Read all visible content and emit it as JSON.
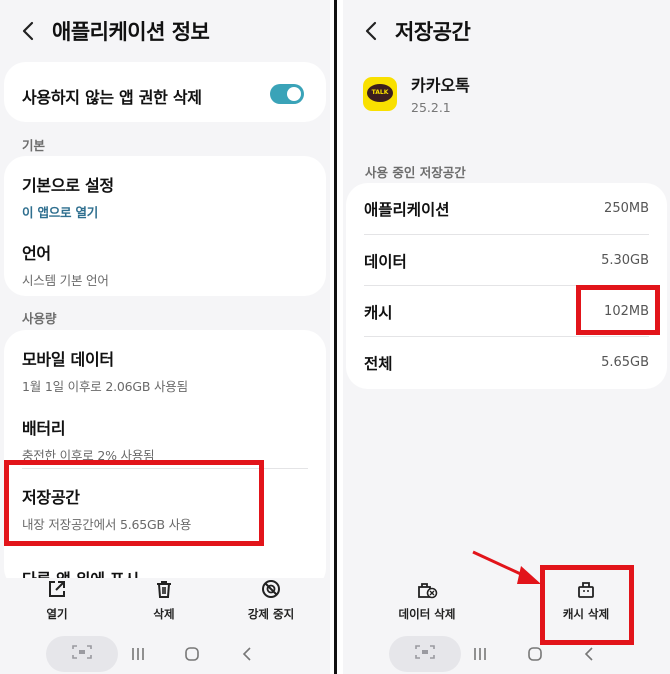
{
  "left_screen": {
    "title": "애플리케이션 정보",
    "toggle_row": {
      "title": "사용하지 않는 앱 권한 삭제",
      "enabled": true
    },
    "section_basic": "기본",
    "basic_items": [
      {
        "title": "기본으로 설정",
        "subtitle": "이 앱으로 열기"
      },
      {
        "title": "언어",
        "subtitle": "시스템 기본 언어"
      }
    ],
    "section_usage": "사용량",
    "usage_items": [
      {
        "title": "모바일 데이터",
        "subtitle": "1월 1일 이후로 2.06GB 사용됨"
      },
      {
        "title": "배터리",
        "subtitle": "충전한 이후로 2% 사용됨"
      },
      {
        "title": "저장공간",
        "subtitle": "내장 저장공간에서 5.65GB 사용"
      },
      {
        "title": "다른 앱 위에 표시",
        "subtitle": ""
      }
    ],
    "bottom_actions": [
      {
        "label": "열기",
        "icon": "open-external-icon"
      },
      {
        "label": "삭제",
        "icon": "trash-icon"
      },
      {
        "label": "강제 중지",
        "icon": "block-icon"
      }
    ]
  },
  "right_screen": {
    "title": "저장공간",
    "app": {
      "name": "카카오톡",
      "version": "25.2.1",
      "logo_text": "TALK"
    },
    "section_label": "사용 중인 저장공간",
    "storage_rows": [
      {
        "key": "애플리케이션",
        "value": "250MB"
      },
      {
        "key": "데이터",
        "value": "5.30GB"
      },
      {
        "key": "캐시",
        "value": "102MB"
      },
      {
        "key": "전체",
        "value": "5.65GB"
      }
    ],
    "bottom_actions": [
      {
        "label": "데이터 삭제",
        "icon": "clear-data-icon"
      },
      {
        "label": "캐시 삭제",
        "icon": "clear-cache-icon"
      }
    ]
  },
  "colors": {
    "accent": "#3aa3b8",
    "highlight": "#e2141a",
    "background": "#f5f5f7",
    "kakao_yellow": "#f9e000"
  }
}
